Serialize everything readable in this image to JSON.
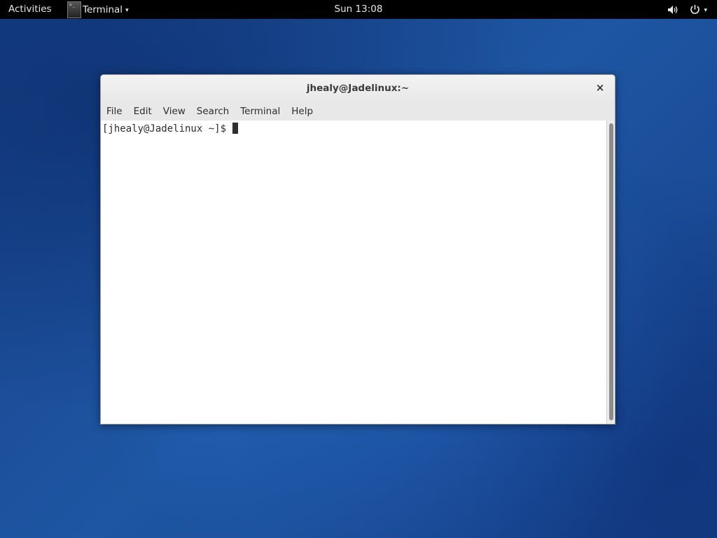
{
  "topbar": {
    "activities": "Activities",
    "app_name": "Terminal",
    "app_icon_text": ">_",
    "clock": "Sun 13:08"
  },
  "window": {
    "title": "jhealy@Jadelinux:~",
    "close_glyph": "×",
    "menu": [
      "File",
      "Edit",
      "View",
      "Search",
      "Terminal",
      "Help"
    ]
  },
  "terminal": {
    "prompt": "[jhealy@Jadelinux ~]$ "
  },
  "colors": {
    "desktop_bg": "#1d4f95",
    "topbar_bg": "#000000"
  },
  "icons": [
    "terminal-app-icon",
    "volume-icon",
    "power-icon",
    "chevron-down-icon",
    "close-icon"
  ]
}
